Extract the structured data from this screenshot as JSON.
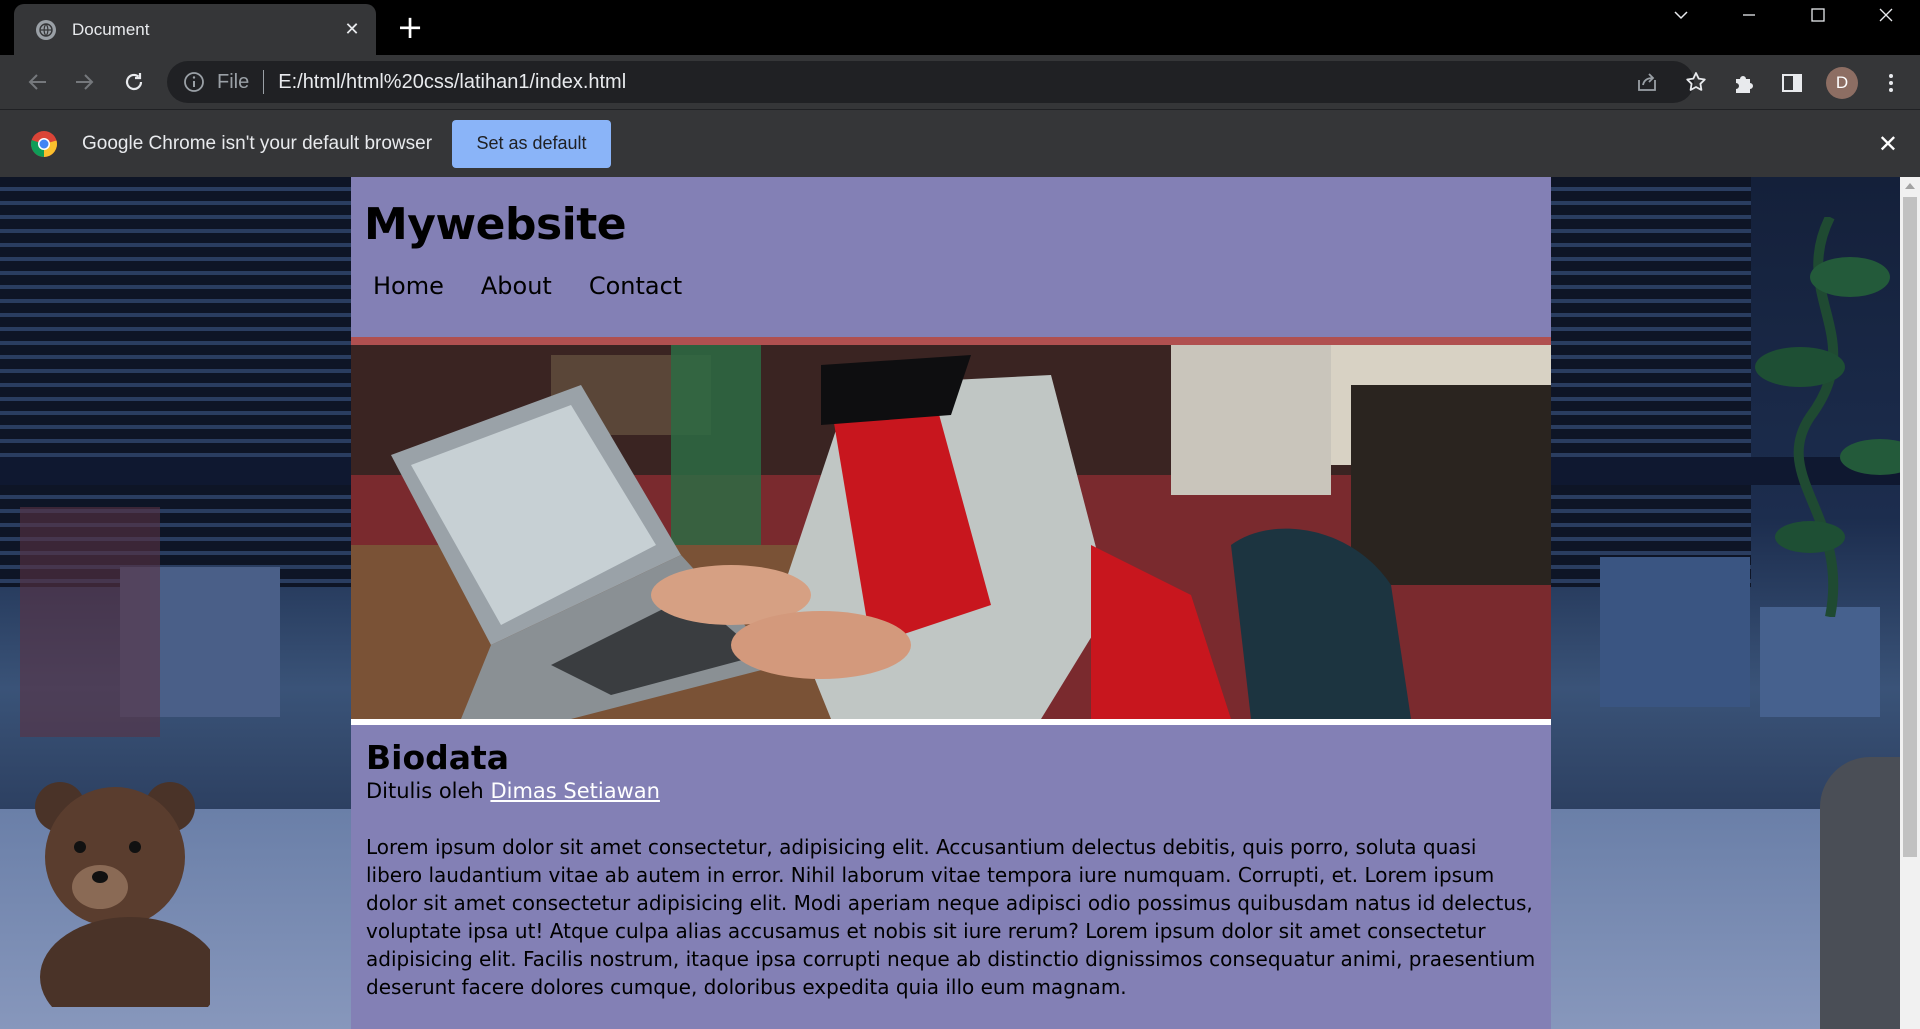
{
  "browser": {
    "tab_title": "Document",
    "tab_close": "✕",
    "new_tab": "+",
    "scheme_label": "File",
    "url": "E:/html/html%20css/latihan1/index.html",
    "avatar_initial": "D",
    "infobar_message": "Google Chrome isn't your default browser",
    "set_default_label": "Set as default",
    "infobar_close": "✕"
  },
  "site": {
    "title": "Mywebsite",
    "nav": [
      "Home",
      "About",
      "Contact"
    ]
  },
  "article": {
    "heading": "Biodata",
    "byline_prefix": "Ditulis oleh",
    "author": "Dimas Setiawan",
    "body": "Lorem ipsum dolor sit amet consectetur, adipisicing elit. Accusantium delectus debitis, quis porro, soluta quasi libero laudantium vitae ab autem in error. Nihil laborum vitae tempora iure numquam. Corrupti, et. Lorem ipsum dolor sit amet consectetur adipisicing elit. Modi aperiam neque adipisci odio possimus quibusdam natus id delectus, voluptate ipsa ut! Atque culpa alias accusamus et nobis sit iure rerum? Lorem ipsum dolor sit amet consectetur adipisicing elit. Facilis nostrum, itaque ipsa corrupti neque ab distinctio dignissimos consequatur animi, praesentium deserunt facere dolores cumque, doloribus expedita quia illo eum magnam."
  },
  "colors": {
    "page_bg": "#8380b5",
    "header_border": "#b05050",
    "button_blue": "#8ab4f8"
  }
}
